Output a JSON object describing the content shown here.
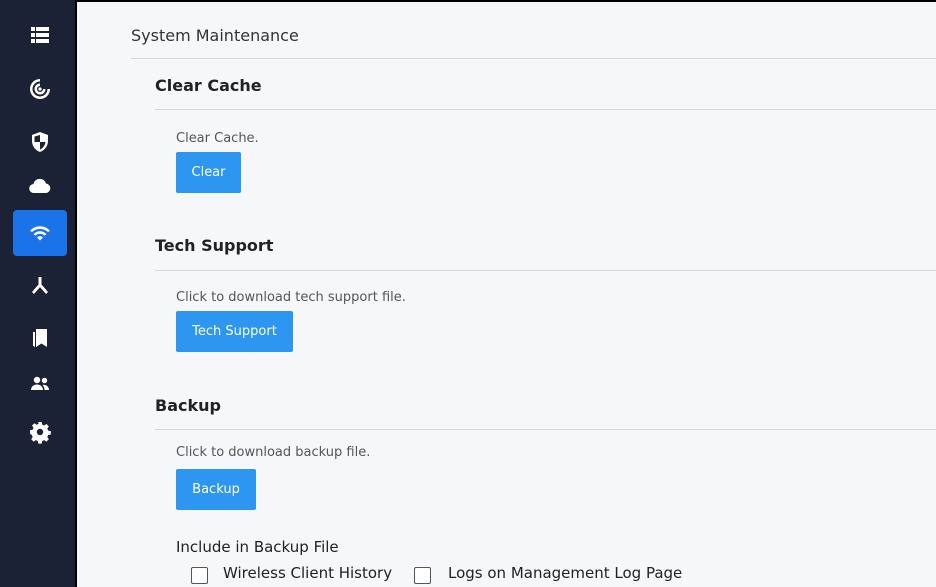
{
  "sidebar": {
    "items": [
      {
        "icon": "list-icon"
      },
      {
        "icon": "radar-icon"
      },
      {
        "icon": "shield-icon"
      },
      {
        "icon": "cloud-icon"
      },
      {
        "icon": "wifi-icon",
        "active": true
      },
      {
        "icon": "network-icon"
      },
      {
        "icon": "bookmarks-icon"
      },
      {
        "icon": "users-icon"
      },
      {
        "icon": "gear-icon"
      }
    ]
  },
  "page": {
    "title": "System Maintenance"
  },
  "clear_cache": {
    "title": "Clear Cache",
    "hint": "Clear Cache.",
    "button": "Clear"
  },
  "tech_support": {
    "title": "Tech Support",
    "hint": "Click to download tech support file.",
    "button": "Tech Support"
  },
  "backup": {
    "title": "Backup",
    "hint": "Click to download backup file.",
    "button": "Backup",
    "include_label": "Include in Backup File",
    "options": [
      {
        "label": "Wireless Client History",
        "checked": false
      },
      {
        "label": "Logs on Management Log Page",
        "checked": false
      }
    ]
  },
  "colors": {
    "sidebar_bg": "#1b2235",
    "active_item": "#1a73e8",
    "button_bg": "#2d96f0"
  }
}
